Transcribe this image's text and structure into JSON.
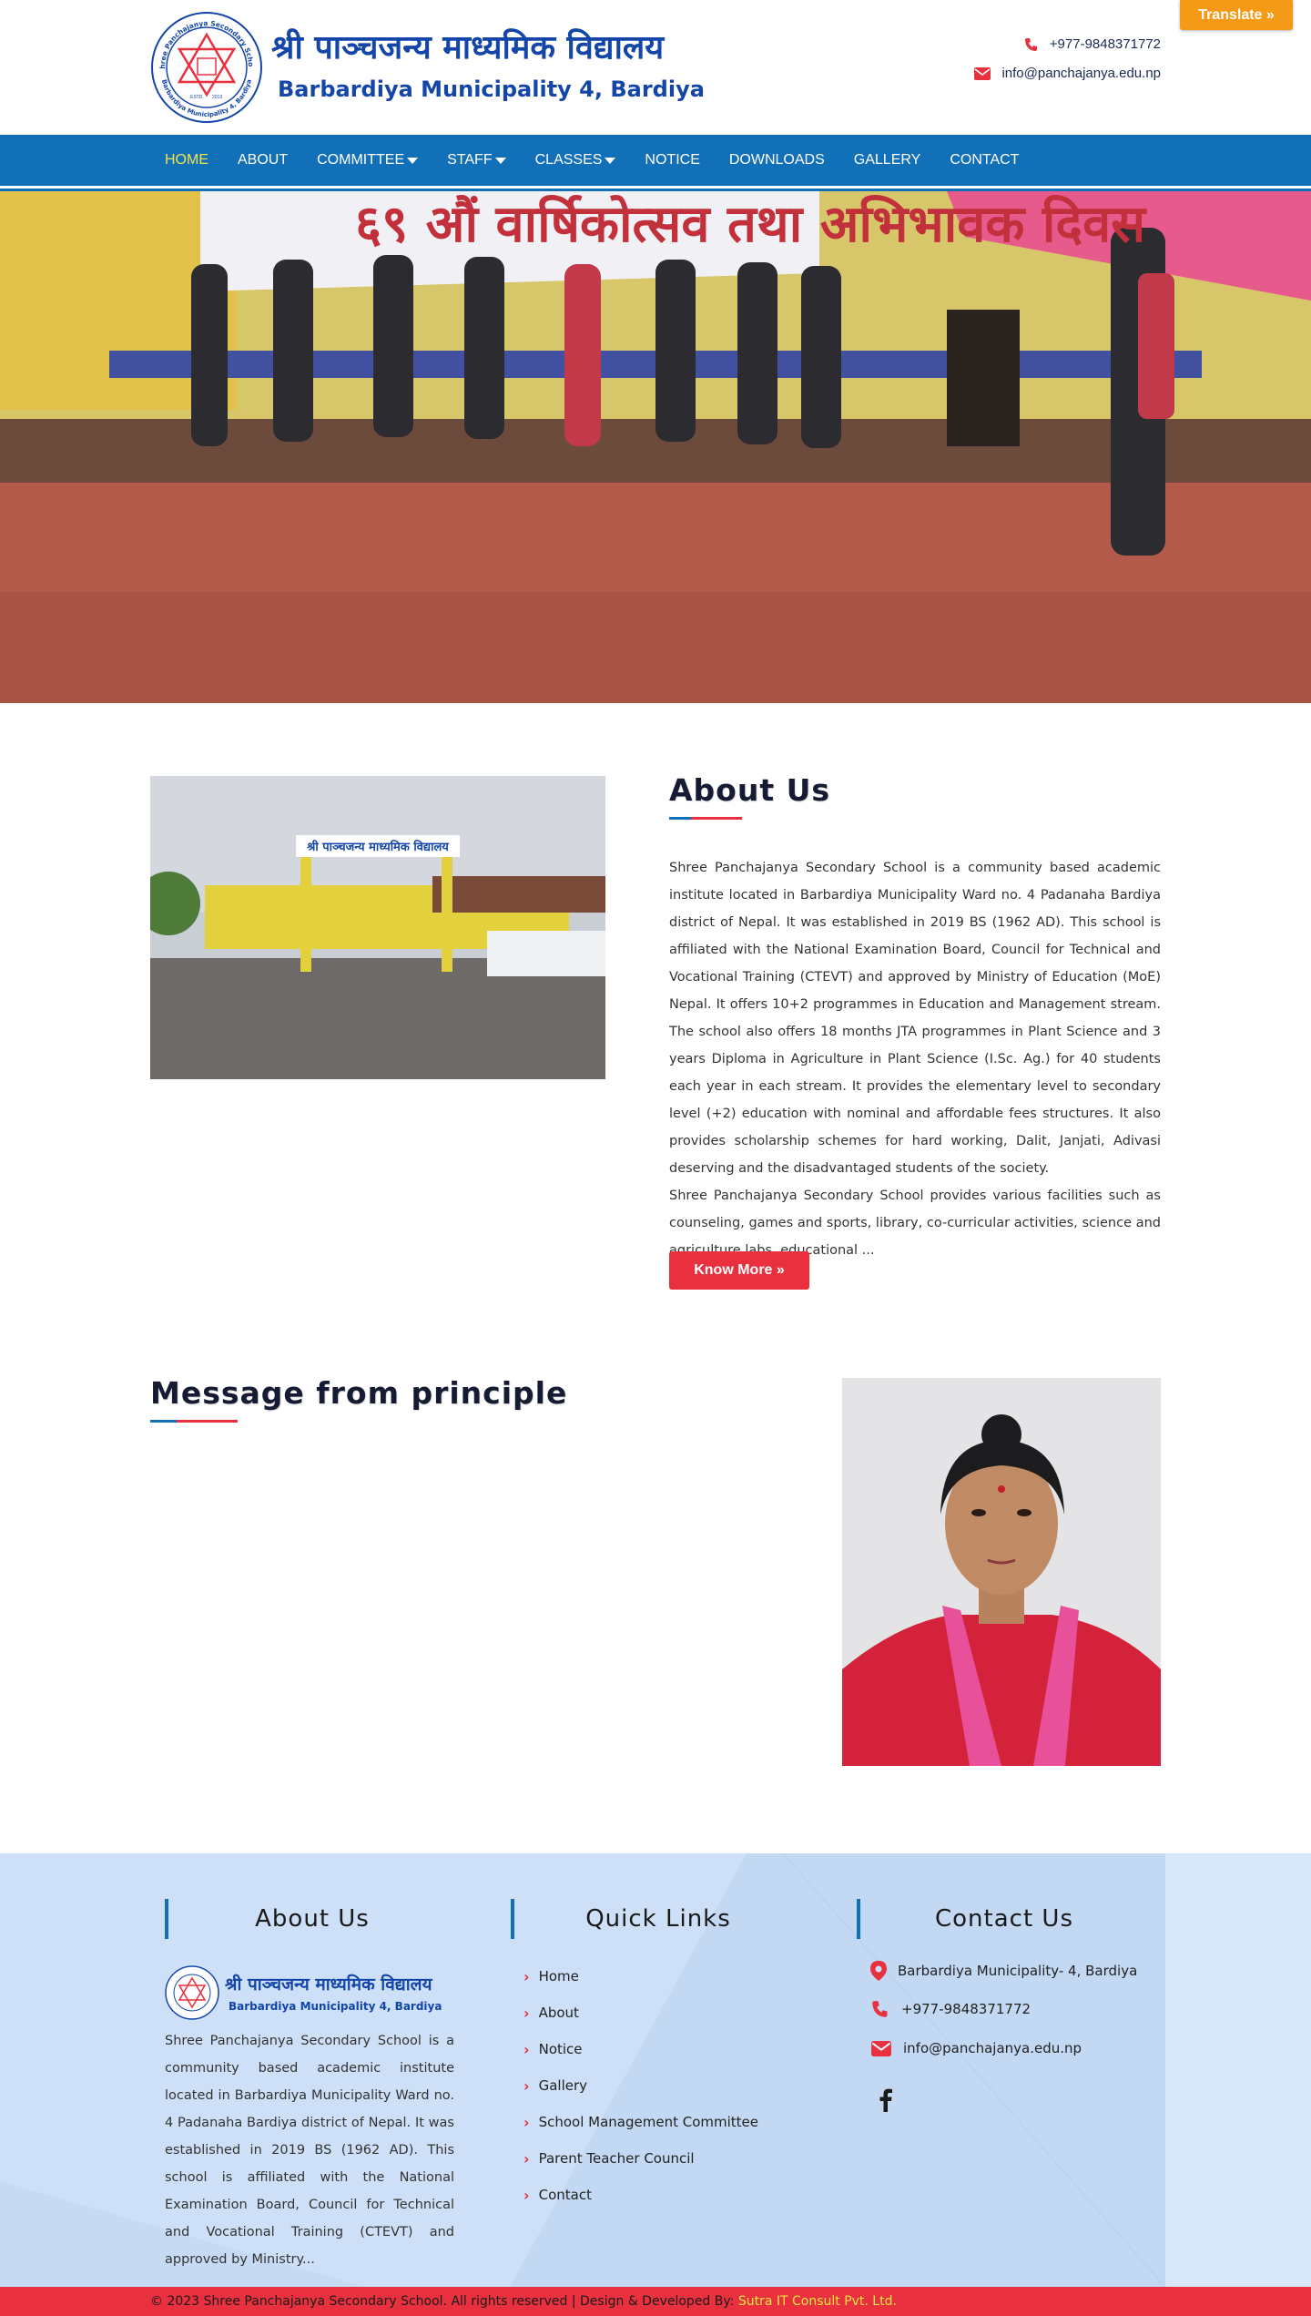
{
  "translate": {
    "label": "Translate »"
  },
  "header": {
    "school_name": "श्री पाञ्चजन्य माध्यमिक विद्यालय",
    "school_sub": "Barbardiya Municipality 4, Bardiya",
    "seal_top_text": "Shree Panchajanya Secondary School",
    "seal_bottom_text": "Barbardiya Municipality 4, Bardiya",
    "seal_estd": "ESTD.",
    "seal_year": "2019",
    "phone": "+977-9848371772",
    "email": "info@panchajanya.edu.np"
  },
  "nav": {
    "items": [
      {
        "label": "HOME",
        "active": true
      },
      {
        "label": "ABOUT"
      },
      {
        "label": "COMMITTEE",
        "dropdown": true
      },
      {
        "label": "STAFF",
        "dropdown": true
      },
      {
        "label": "CLASSES",
        "dropdown": true
      },
      {
        "label": "NOTICE"
      },
      {
        "label": "DOWNLOADS"
      },
      {
        "label": "GALLERY"
      },
      {
        "label": "CONTACT"
      }
    ]
  },
  "hero": {
    "banner_text": "६९ औं वार्षिकोत्सव तथा अभिभावक दिवस"
  },
  "about": {
    "title": "About Us",
    "gate_sign": "श्री पाञ्चजन्य माध्यमिक विद्यालय",
    "paragraph1": "Shree Panchajanya Secondary School is a community based academic institute located in Barbardiya Municipality Ward no. 4 Padanaha Bardiya district of Nepal. It was established in 2019 BS (1962 AD). This school is affiliated with the National Examination Board, Council for Technical and Vocational Training (CTEVT) and approved by Ministry of Education (MoE) Nepal. It offers 10+2 programmes in Education and Management stream. The school also offers 18 months JTA programmes in Plant Science and 3 years Diploma in Agriculture in Plant Science (I.Sc. Ag.) for 40 students each year in each stream. It provides the elementary level to secondary level (+2) education with nominal and affordable fees structures. It also provides scholarship schemes for hard working, Dalit, Janjati, Adivasi deserving and the disadvantaged students of the society.",
    "paragraph2": "Shree Panchajanya Secondary School provides various facilities such as counseling, games and sports, library, co-curricular activities, science and agriculture labs, educational ...",
    "button": "Know More »"
  },
  "message": {
    "title": "Message from principle"
  },
  "footer": {
    "about_title": "About Us",
    "quick_title": "Quick Links",
    "contact_title": "Contact Us",
    "about_text": "Shree Panchajanya Secondary School is a community based academic institute located in Barbardiya Municipality Ward no. 4 Padanaha Bardiya district of Nepal. It was established in 2019 BS (1962 AD). This school is affiliated with the National Examination Board, Council for Technical and Vocational Training (CTEVT) and approved by Ministry...",
    "logo_name": "श्री पाञ्चजन्य माध्यमिक विद्यालय",
    "logo_sub": "Barbardiya Municipality 4, Bardiya",
    "links": [
      "Home",
      "About",
      "Notice",
      "Gallery",
      "School Management Committee",
      "Parent Teacher Council",
      "Contact"
    ],
    "address": "Barbardiya Municipality- 4, Bardiya",
    "phone": "+977-9848371772",
    "email": "info@panchajanya.edu.np"
  },
  "copyright": {
    "text": "© 2023 Shree Panchajanya Secondary School. All rights reserved | Design & Developed By: ",
    "developer": "Sutra IT Consult Pvt. Ltd."
  },
  "colors": {
    "nav": "#1270b8",
    "accent": "#e8303e",
    "brand": "#1346a8",
    "footer": "#cde0f7",
    "translate": "#f59a16"
  }
}
